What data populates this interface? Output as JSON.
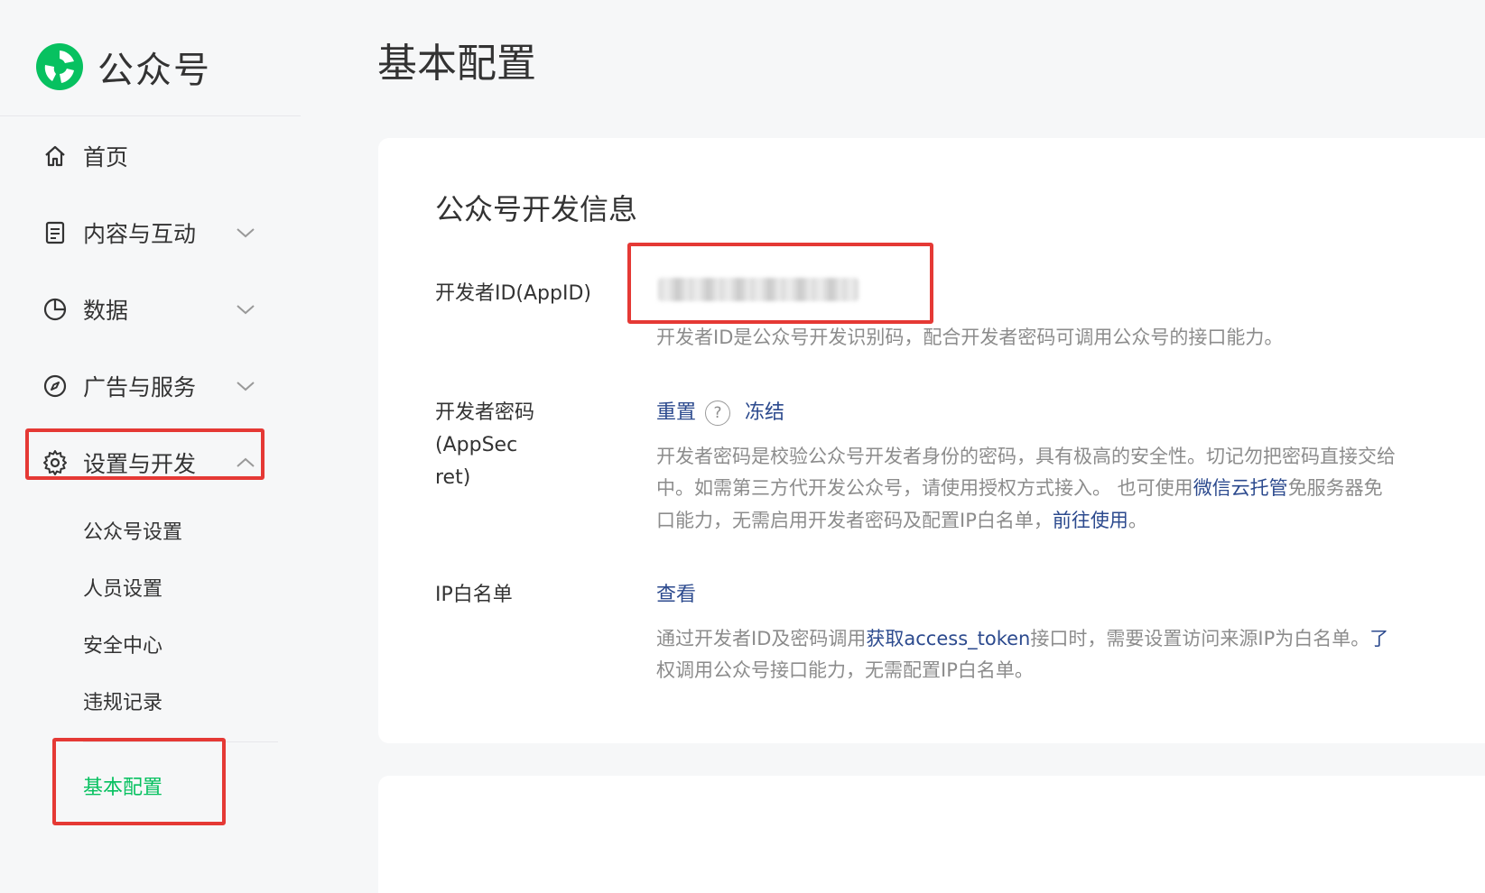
{
  "brand": {
    "name": "公众号"
  },
  "sidebar": {
    "items": [
      {
        "label": "首页",
        "icon": "home-icon"
      },
      {
        "label": "内容与互动",
        "icon": "document-icon"
      },
      {
        "label": "数据",
        "icon": "pie-chart-icon"
      },
      {
        "label": "广告与服务",
        "icon": "compass-icon"
      },
      {
        "label": "设置与开发",
        "icon": "gear-icon"
      }
    ],
    "sub_items": [
      {
        "label": "公众号设置"
      },
      {
        "label": "人员设置"
      },
      {
        "label": "安全中心"
      },
      {
        "label": "违规记录"
      },
      {
        "label": "基本配置"
      }
    ]
  },
  "main": {
    "page_title": "基本配置",
    "section_title": "公众号开发信息",
    "appid": {
      "label": "开发者ID(AppID)",
      "desc": "开发者ID是公众号开发识别码，配合开发者密码可调用公众号的接口能力。"
    },
    "appsecret": {
      "label_line1": "开发者密码(AppSec",
      "label_line2": "ret)",
      "reset": "重置",
      "help": "?",
      "freeze": "冻结",
      "desc_line1": "开发者密码是校验公众号开发者身份的密码，具有极高的安全性。切记勿把密码直接交给",
      "desc_line2_a": "中。如需第三方代开发公众号，请使用授权方式接入。 也可使用",
      "desc_line2_link": "微信云托管",
      "desc_line2_b": "免服务器免",
      "desc_line3_a": "口能力，无需启用开发者密码及配置IP白名单，",
      "desc_line3_link": "前往使用",
      "desc_line3_b": "。"
    },
    "ip_whitelist": {
      "label": "IP白名单",
      "view": "查看",
      "desc_line1_a": "通过开发者ID及密码调用",
      "desc_line1_link": "获取access_token",
      "desc_line1_b": "接口时，需要设置访问来源IP为白名单。",
      "desc_line1_link2": "了",
      "desc_line2": "权调用公众号接口能力，无需配置IP白名单。"
    }
  },
  "colors": {
    "accent": "#07c160",
    "link": "#2c4a8e",
    "highlight_box": "#e53935"
  }
}
